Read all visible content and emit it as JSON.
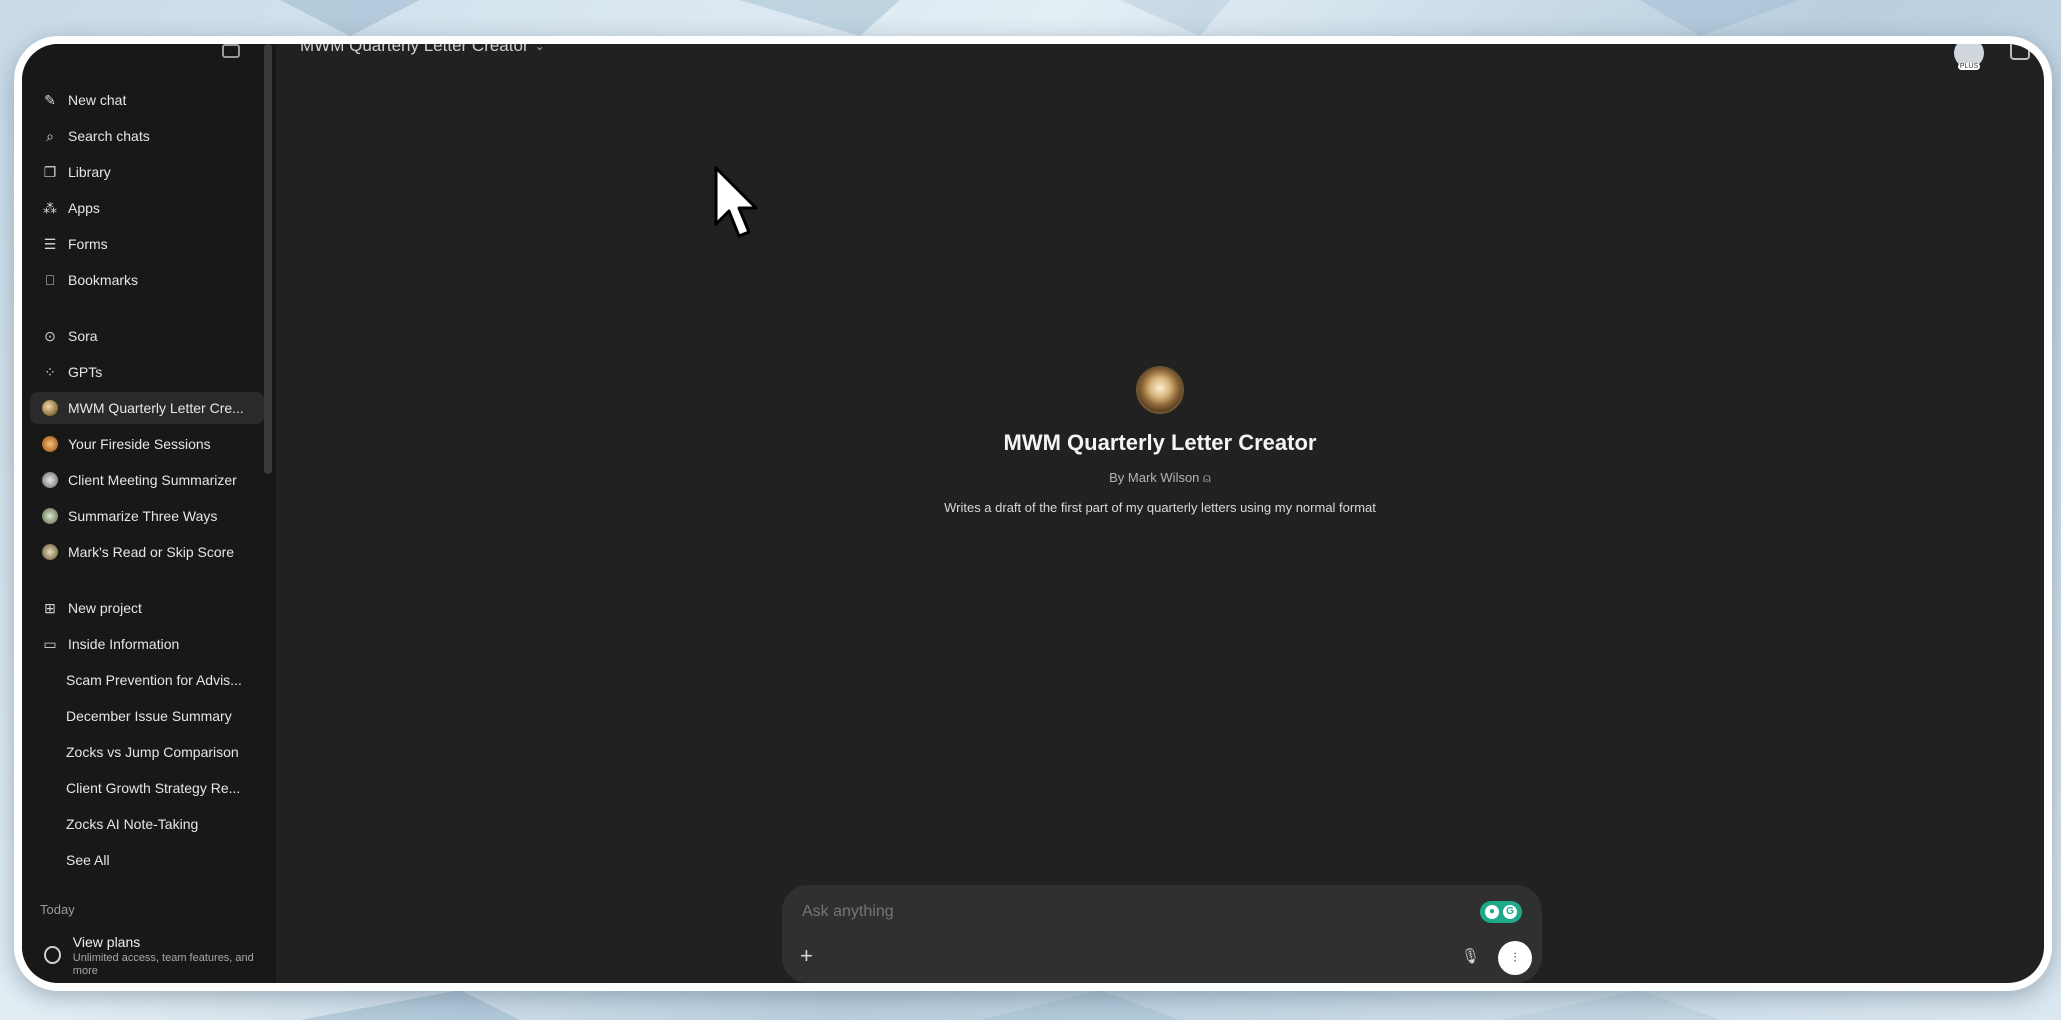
{
  "header": {
    "gpt_title": "MWM Quarterly Letter Creator",
    "avatar_badge": "PLUS"
  },
  "sidebar": {
    "nav": [
      {
        "label": "New chat",
        "icon": "new-chat-icon"
      },
      {
        "label": "Search chats",
        "icon": "search-icon"
      },
      {
        "label": "Library",
        "icon": "library-icon"
      },
      {
        "label": "Apps",
        "icon": "apps-icon"
      },
      {
        "label": "Forms",
        "icon": "forms-icon"
      },
      {
        "label": "Bookmarks",
        "icon": "bookmark-icon"
      }
    ],
    "explore": [
      {
        "label": "Sora",
        "icon": "sora-icon"
      },
      {
        "label": "GPTs",
        "icon": "gpts-icon"
      }
    ],
    "gpts": [
      {
        "label": "MWM Quarterly Letter Cre..."
      },
      {
        "label": "Your Fireside Sessions"
      },
      {
        "label": "Client Meeting Summarizer"
      },
      {
        "label": "Summarize Three Ways"
      },
      {
        "label": "Mark's Read or Skip Score"
      }
    ],
    "projects": {
      "new_project": "New project",
      "folder": "Inside Information",
      "items": [
        "Scam Prevention for Advis...",
        "December Issue Summary",
        "Zocks vs Jump Comparison",
        "Client Growth Strategy Re...",
        "Zocks AI Note-Taking",
        "See All"
      ]
    },
    "section_today": "Today",
    "plans": {
      "title": "View plans",
      "subtitle": "Unlimited access, team features, and more"
    }
  },
  "main": {
    "title": "MWM Quarterly Letter Creator",
    "by": "By Mark Wilson",
    "description": "Writes a draft of the first part of my quarterly letters using my normal format"
  },
  "composer": {
    "placeholder": "Ask anything"
  },
  "colors": {
    "background": "#212121",
    "sidebar": "#181818",
    "composer": "#303030",
    "grammarly": "#1eaa8a"
  }
}
